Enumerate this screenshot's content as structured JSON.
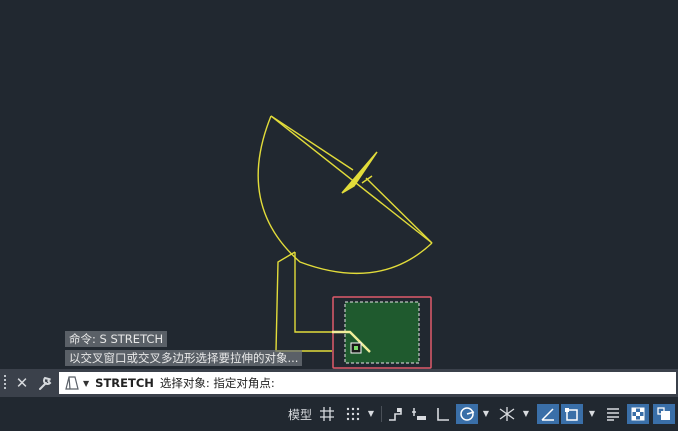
{
  "history": {
    "line1": "命令: S STRETCH",
    "line2": "以交叉窗口或交叉多边形选择要拉伸的对象..."
  },
  "command_line": {
    "command": "STRETCH",
    "prompt": "选择对象: 指定对角点:",
    "close_label": "✕",
    "customize_icon": "wrench-icon"
  },
  "status_bar": {
    "model_label": "模型",
    "icons": [
      "grid-icon",
      "snap-grid-icon",
      "infer-constraints-icon",
      "dynamic-input-icon",
      "ortho-icon",
      "polar-icon",
      "isodraft-icon",
      "object-snap-tracking-icon",
      "object-snap-icon",
      "lineweight-icon",
      "transparency-icon",
      "selection-cycling-icon"
    ]
  },
  "colors": {
    "canvas": "#212830",
    "drawing": "#e2dc3a",
    "selection_fill": "#1f5a2e",
    "crossing_box": "#e05a6a",
    "active_toggle": "#3a6fa8"
  }
}
